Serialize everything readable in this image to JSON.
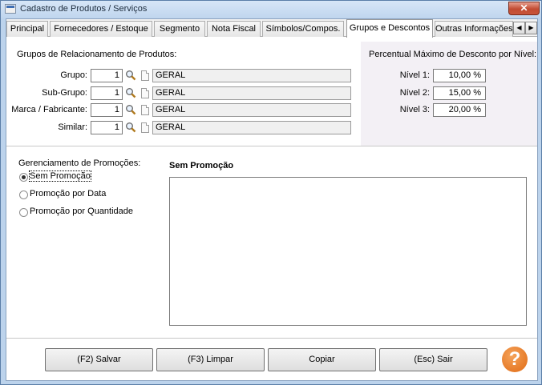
{
  "window": {
    "title": "Cadastro de Produtos / Serviços",
    "close_glyph": "✕"
  },
  "tabs": [
    {
      "label": "Principal"
    },
    {
      "label": "Fornecedores / Estoque"
    },
    {
      "label": "Segmento"
    },
    {
      "label": "Nota Fiscal"
    },
    {
      "label": "Símbolos/Compos."
    },
    {
      "label": "Grupos e Descontos",
      "active": true
    },
    {
      "label": "Outras Informações"
    }
  ],
  "tab_scroll": {
    "left": "◀",
    "right": "▶"
  },
  "groups": {
    "title": "Grupos de Relacionamento de Produtos:",
    "rows": [
      {
        "label": "Grupo:",
        "value": "1",
        "description": "GERAL"
      },
      {
        "label": "Sub-Grupo:",
        "value": "1",
        "description": "GERAL"
      },
      {
        "label": "Marca / Fabricante:",
        "value": "1",
        "description": "GERAL"
      },
      {
        "label": "Similar:",
        "value": "1",
        "description": "GERAL"
      }
    ]
  },
  "discount": {
    "title": "Percentual Máximo de Desconto por Nível:",
    "levels": [
      {
        "label": "Nível 1:",
        "value": "10,00 %"
      },
      {
        "label": "Nível 2:",
        "value": "15,00 %"
      },
      {
        "label": "Nível 3:",
        "value": "20,00 %"
      }
    ]
  },
  "promotions": {
    "title": "Gerenciamento de Promoções:",
    "options": [
      {
        "label": "Sem Promoção",
        "checked": true
      },
      {
        "label": "Promoção por Data",
        "checked": false
      },
      {
        "label": "Promoção por Quantidade",
        "checked": false
      }
    ],
    "selected_title": "Sem Promoção"
  },
  "buttons": {
    "save": "(F2) Salvar",
    "clear": "(F3) Limpar",
    "copy": "Copiar",
    "exit": "(Esc) Sair"
  },
  "help_glyph": "?"
}
